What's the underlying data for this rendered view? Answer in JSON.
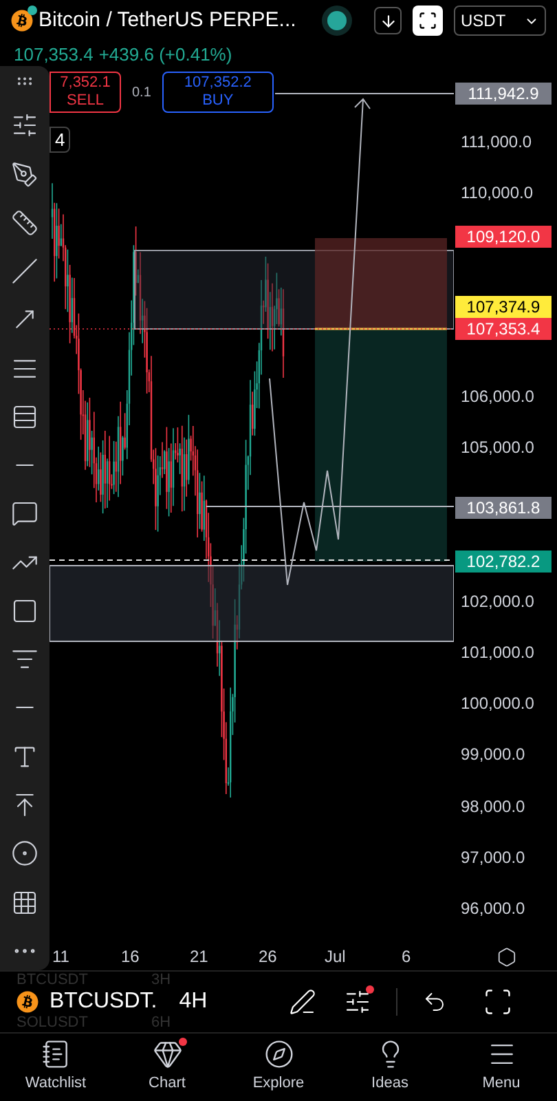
{
  "header": {
    "title": "Bitcoin / TetherUS PERPE...",
    "live": true,
    "currency": "USDT"
  },
  "quote": {
    "price": "107,353.4",
    "change": "+439.6 (+0.41%)"
  },
  "order": {
    "sell_price": "7,352.1",
    "sell_label": "SELL",
    "quantity": "0.1",
    "buy_price": "107,352.2",
    "buy_label": "BUY"
  },
  "interval_badge": "4",
  "price_axis": [
    {
      "text": "111,942.9",
      "kind": "marker",
      "color": "#787b86"
    },
    {
      "text": "111,000.0",
      "kind": "tick"
    },
    {
      "text": "110,000.0",
      "kind": "tick"
    },
    {
      "text": "109,120.0",
      "kind": "marker",
      "color": "#f23645"
    },
    {
      "text": "107,374.9",
      "kind": "marker",
      "color": "#ffeb3b"
    },
    {
      "text": "107,353.4",
      "kind": "marker",
      "color": "#f23645"
    },
    {
      "text": "106,000.0",
      "kind": "tick"
    },
    {
      "text": "105,000.0",
      "kind": "tick"
    },
    {
      "text": "103,861.8",
      "kind": "marker",
      "color": "#787b86"
    },
    {
      "text": "102,782.2",
      "kind": "marker",
      "color": "#089981"
    },
    {
      "text": "102,000.0",
      "kind": "tick"
    },
    {
      "text": "101,000.0",
      "kind": "tick"
    },
    {
      "text": "100,000.0",
      "kind": "tick"
    },
    {
      "text": "99,000.0",
      "kind": "tick"
    },
    {
      "text": "98,000.0",
      "kind": "tick"
    },
    {
      "text": "97,000.0",
      "kind": "tick"
    },
    {
      "text": "96,000.0",
      "kind": "tick"
    }
  ],
  "time_axis": [
    "11",
    "16",
    "21",
    "26",
    "Jul",
    "6"
  ],
  "symbol_bar": {
    "above_symbol": "BTCUSDT",
    "above_interval": "3H",
    "symbol": "BTCUSDT.",
    "interval": "4H",
    "below_symbol": "SOLUSDT",
    "below_interval": "6H",
    "indicator_alert": true
  },
  "nav": [
    {
      "label": "Watchlist",
      "notification": false
    },
    {
      "label": "Chart",
      "notification": true
    },
    {
      "label": "Explore",
      "notification": false
    },
    {
      "label": "Ideas",
      "notification": false
    },
    {
      "label": "Menu",
      "notification": false
    }
  ]
}
